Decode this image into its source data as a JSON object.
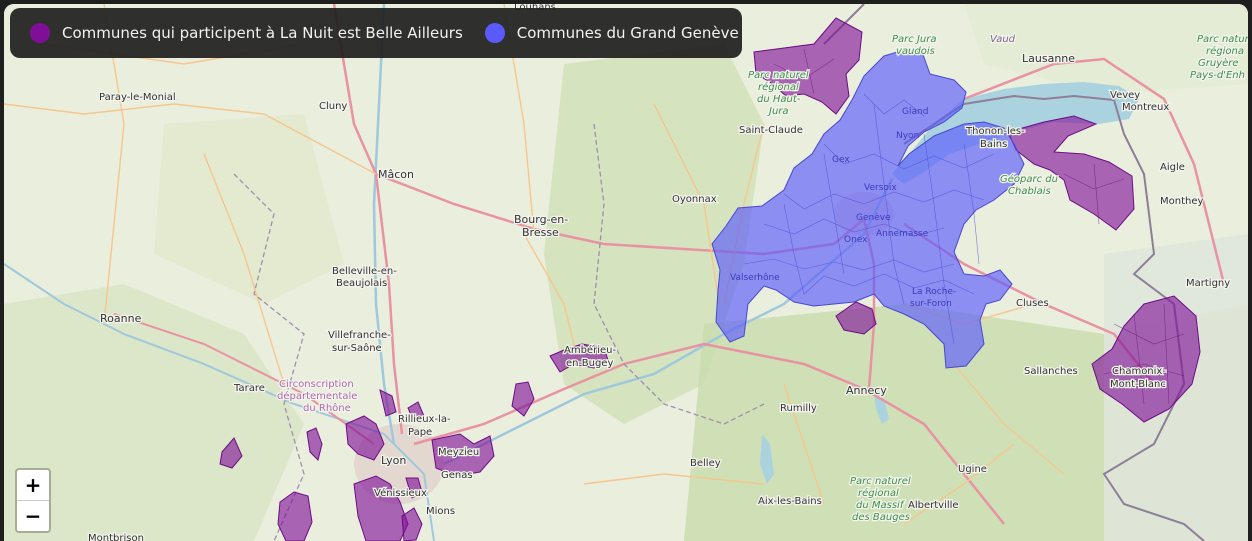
{
  "legend": {
    "items": [
      {
        "label": "Communes qui participent à La Nuit est Belle Ailleurs",
        "color": "#7f0f98"
      },
      {
        "label": "Communes du Grand Genève",
        "color": "#5a5afc"
      }
    ]
  },
  "zoom": {
    "in_label": "+",
    "out_label": "−"
  },
  "places": {
    "louhans": "Louhans",
    "paray": "Paray-le-Monial",
    "cluny": "Cluny",
    "macon": "Mâcon",
    "bourg1": "Bourg-en-",
    "bourg2": "Bresse",
    "belleville1": "Belleville-en-",
    "belleville2": "Beaujolais",
    "roanne": "Roanne",
    "villefranche1": "Villefranche-",
    "villefranche2": "sur-Saône",
    "tarare": "Tarare",
    "circ1": "Circonscription",
    "circ2": "départementale",
    "circ3": "du Rhône",
    "rillieux1": "Rillieux-la-",
    "rillieux2": "Pape",
    "lyon": "Lyon",
    "meyzieu": "Meyzieu",
    "genas": "Genas",
    "venissieux": "Vénissieux",
    "mions": "Mions",
    "montbrison": "Montbrison",
    "amberieu1": "Ambérieu-",
    "amberieu2": "en-Bugey",
    "oyonnax": "Oyonnax",
    "saintclaude": "Saint-Claude",
    "pnhj1": "Parc naturel",
    "pnhj2": "régional",
    "pnhj3": "du Haut-",
    "pnhj4": "Jura",
    "jura1": "Parc Jura",
    "jura2": "vaudois",
    "vaud": "Vaud",
    "lausanne": "Lausanne",
    "vevey": "Vevey",
    "montreux": "Montreux",
    "gruyere1": "Parc natur",
    "gruyere2": "régiona",
    "gruyere3": "Gruyère",
    "gruyere4": "Pays-d'Enh",
    "gland": "Gland",
    "nyon": "Nyon",
    "gex": "Gex",
    "versoix": "Versoix",
    "geneve": "Genève",
    "onex": "Onex",
    "annemasse": "Annemasse",
    "thonon1": "Thonon-les-",
    "thonon2": "Bains",
    "chablais1": "Géoparc du",
    "chablais2": "Chablais",
    "aigle": "Aigle",
    "monthey": "Monthey",
    "valserhone": "Valserhône",
    "laroche1": "La Roche-",
    "laroche2": "sur-Foron",
    "cluses": "Cluses",
    "martigny": "Martigny",
    "sallanches": "Sallanches",
    "chamonix1": "Chamonix-",
    "chamonix2": "Mont-Blanc",
    "annecy": "Annecy",
    "rumilly": "Rumilly",
    "belley": "Belley",
    "ugine": "Ugine",
    "albertville": "Albertville",
    "aixlesbains": "Aix-les-Bains",
    "bauges1": "Parc naturel",
    "bauges2": "régional",
    "bauges3": "du Massif",
    "bauges4": "des Bauges"
  }
}
